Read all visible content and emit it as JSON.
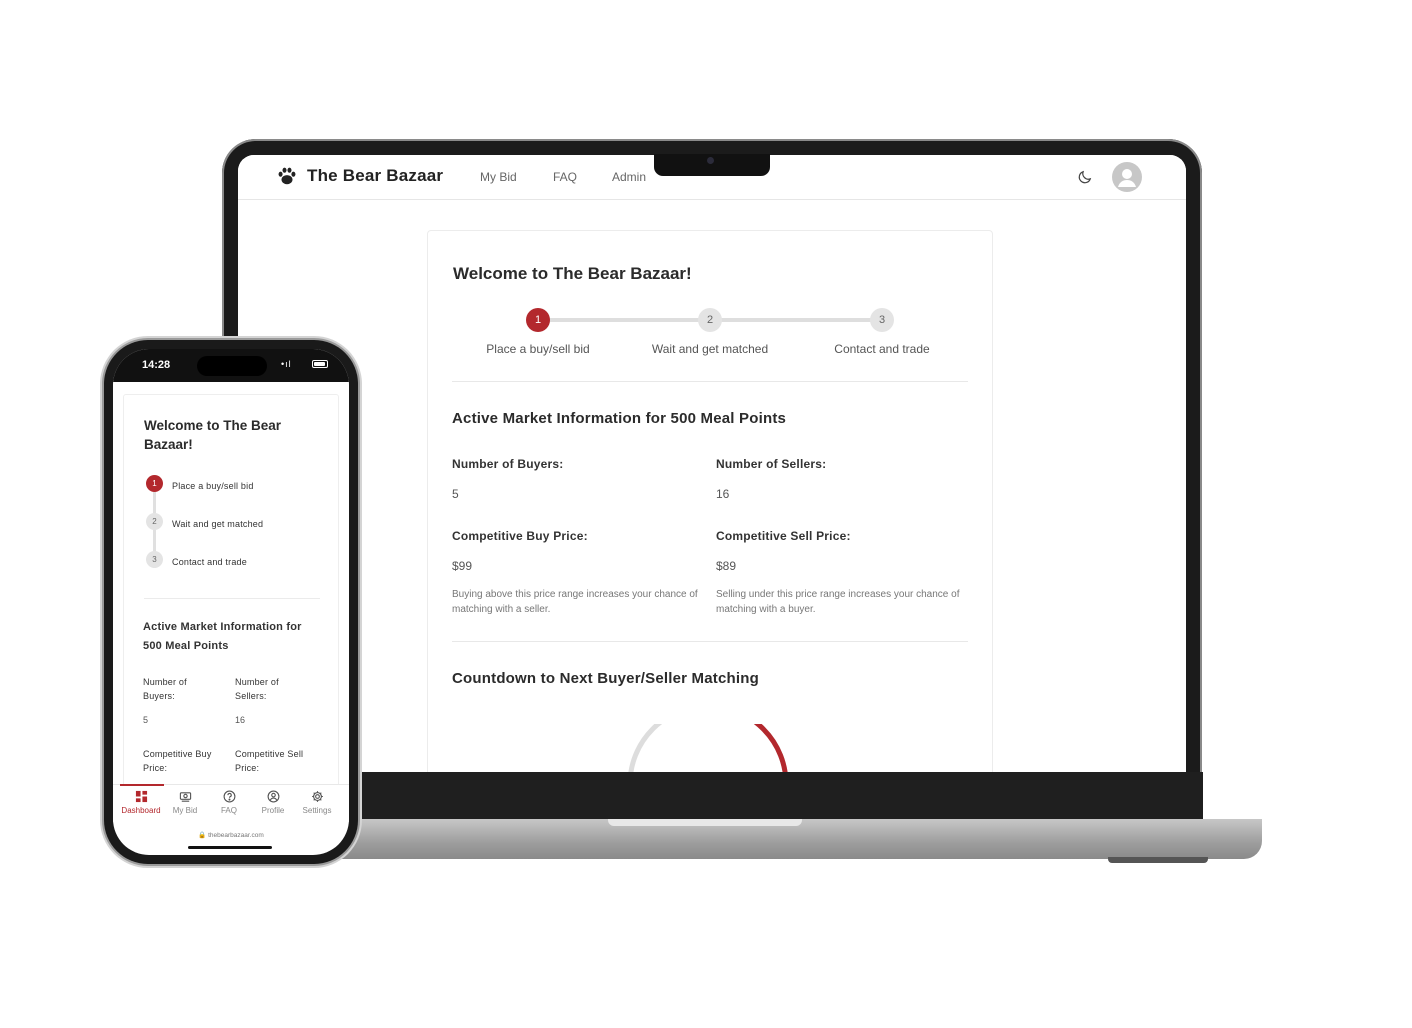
{
  "colors": {
    "accent": "#b3282d",
    "inactive_step": "#e4e4e4",
    "gauge_track": "#dddddd"
  },
  "desktop": {
    "brand": {
      "name": "The Bear Bazaar",
      "logo_icon": "paw-icon"
    },
    "nav": [
      {
        "label": "My Bid"
      },
      {
        "label": "FAQ"
      },
      {
        "label": "Admin"
      }
    ],
    "actions": {
      "theme_icon": "moon-icon",
      "avatar_icon": "user-avatar-icon"
    },
    "welcome_title": "Welcome to The Bear Bazaar!",
    "steps": [
      {
        "number": "1",
        "label": "Place a buy/sell bid",
        "active": true
      },
      {
        "number": "2",
        "label": "Wait and get matched",
        "active": false
      },
      {
        "number": "3",
        "label": "Contact and trade",
        "active": false
      }
    ],
    "market": {
      "title": "Active Market Information for 500 Meal Points",
      "buyers_label": "Number of Buyers:",
      "buyers_value": "5",
      "sellers_label": "Number of Sellers:",
      "sellers_value": "16",
      "buy_price_label": "Competitive Buy Price:",
      "buy_price_value": "$99",
      "buy_hint": "Buying above this price range increases your chance of matching with a seller.",
      "sell_price_label": "Competitive Sell Price:",
      "sell_price_value": "$89",
      "sell_hint": "Selling under this price range increases your chance of matching with a buyer."
    },
    "countdown": {
      "title": "Countdown to Next Buyer/Seller Matching",
      "progress_fraction": 0.5
    }
  },
  "mobile": {
    "status": {
      "time": "14:28",
      "signal": "•ıl"
    },
    "welcome_title": "Welcome to The Bear Bazaar!",
    "steps": [
      {
        "number": "1",
        "label": "Place a buy/sell bid",
        "active": true
      },
      {
        "number": "2",
        "label": "Wait and get matched",
        "active": false
      },
      {
        "number": "3",
        "label": "Contact and trade",
        "active": false
      }
    ],
    "market": {
      "title": "Active Market Information for 500 Meal Points",
      "buyers_label": "Number of Buyers:",
      "buyers_value": "5",
      "sellers_label": "Number of Sellers:",
      "sellers_value": "16",
      "buy_price_label": "Competitive Buy Price:",
      "sell_price_label": "Competitive Sell Price:"
    },
    "tabs": [
      {
        "label": "Dashboard",
        "icon": "dashboard-icon",
        "active": true
      },
      {
        "label": "My Bid",
        "icon": "bid-icon",
        "active": false
      },
      {
        "label": "FAQ",
        "icon": "help-icon",
        "active": false
      },
      {
        "label": "Profile",
        "icon": "profile-icon",
        "active": false
      },
      {
        "label": "Settings",
        "icon": "gear-icon",
        "active": false
      }
    ],
    "url": "thebearbazaar.com"
  }
}
